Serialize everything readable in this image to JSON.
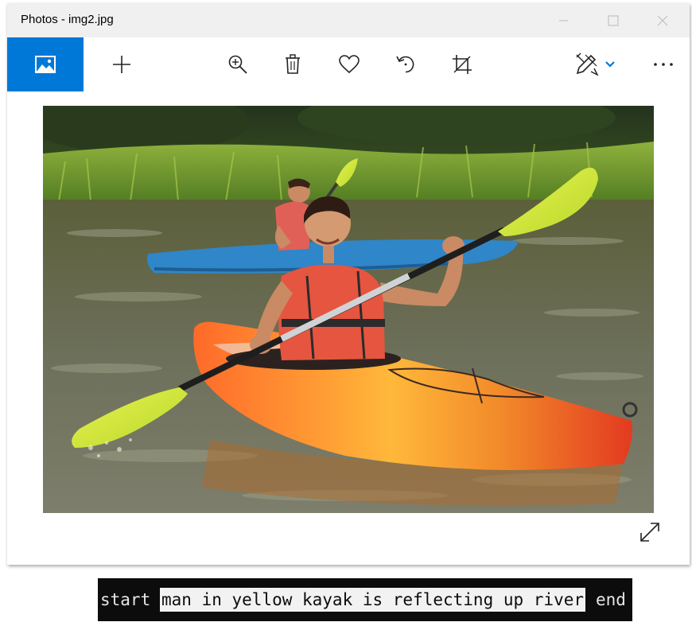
{
  "window": {
    "title": "Photos - img2.jpg"
  },
  "toolbar": {
    "items": [
      {
        "name": "gallery",
        "icon": "picture-icon",
        "active": true
      },
      {
        "name": "add",
        "icon": "plus-icon"
      },
      {
        "name": "zoom",
        "icon": "zoom-in-icon"
      },
      {
        "name": "delete",
        "icon": "trash-icon"
      },
      {
        "name": "favorite",
        "icon": "heart-icon"
      },
      {
        "name": "rotate",
        "icon": "rotate-icon"
      },
      {
        "name": "crop",
        "icon": "crop-icon"
      },
      {
        "name": "edit",
        "icon": "edit-create-icon"
      },
      {
        "name": "more",
        "icon": "ellipsis-icon"
      }
    ],
    "more_label": "···"
  },
  "colors": {
    "accent": "#0078d7",
    "titlebar": "#f0f0f0",
    "caption_bg": "#0c0c0c"
  },
  "caption": {
    "start": "start",
    "text": "man in yellow kayak is reflecting up river",
    "end": "end"
  }
}
